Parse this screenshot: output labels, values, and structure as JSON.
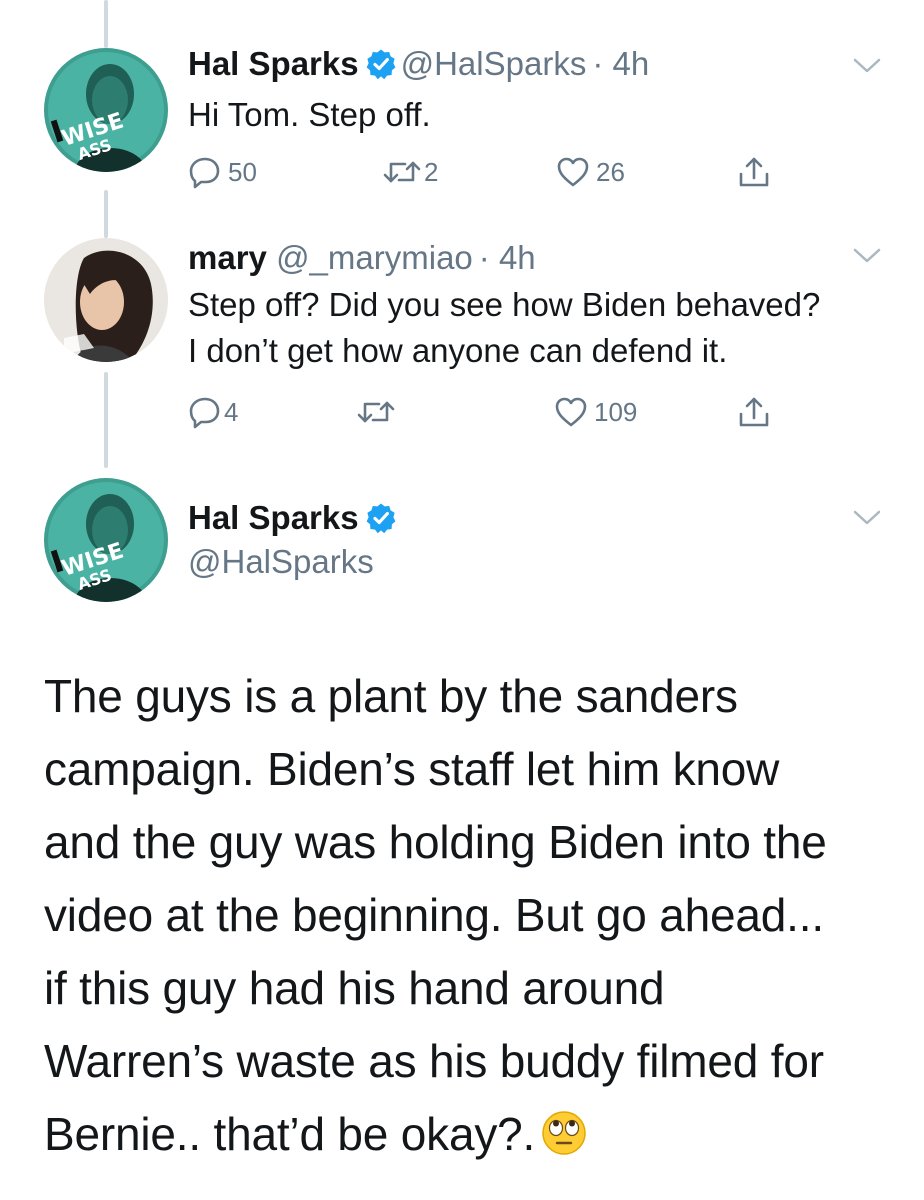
{
  "tweets": [
    {
      "name": "Hal Sparks",
      "handle": "@HalSparks",
      "time": "· 4h",
      "text": "Hi Tom. Step off.",
      "replies": "50",
      "retweets": "2",
      "likes": "26",
      "avatar_text_top": "WISE",
      "avatar_text_bottom": "ASS"
    },
    {
      "name": "mary",
      "handle": "@_marymiao",
      "time": "· 4h",
      "text_lines": [
        "Step off? Did you see how Biden behaved?",
        "I don’t get how anyone can defend it."
      ],
      "replies": "4",
      "retweets": "",
      "likes": "109"
    }
  ],
  "main_tweet": {
    "name": "Hal Sparks",
    "handle": "@HalSparks",
    "avatar_text_top": "WISE",
    "avatar_text_bottom": "ASS",
    "text_lines": [
      "The guys is a plant by the sanders",
      "campaign. Biden’s staff let him know",
      "and the guy was holding Biden into the",
      "video at the beginning. But go ahead...",
      "if this guy had his hand around",
      "Warren’s waste as his buddy filmed for",
      "Bernie.. that’d be okay?."
    ],
    "emoji": "eye-roll-emoji"
  },
  "colors": {
    "verified": "#1da1f2",
    "text": "#14171a",
    "secondary": "#657786",
    "thread_line": "#cfd9de"
  }
}
